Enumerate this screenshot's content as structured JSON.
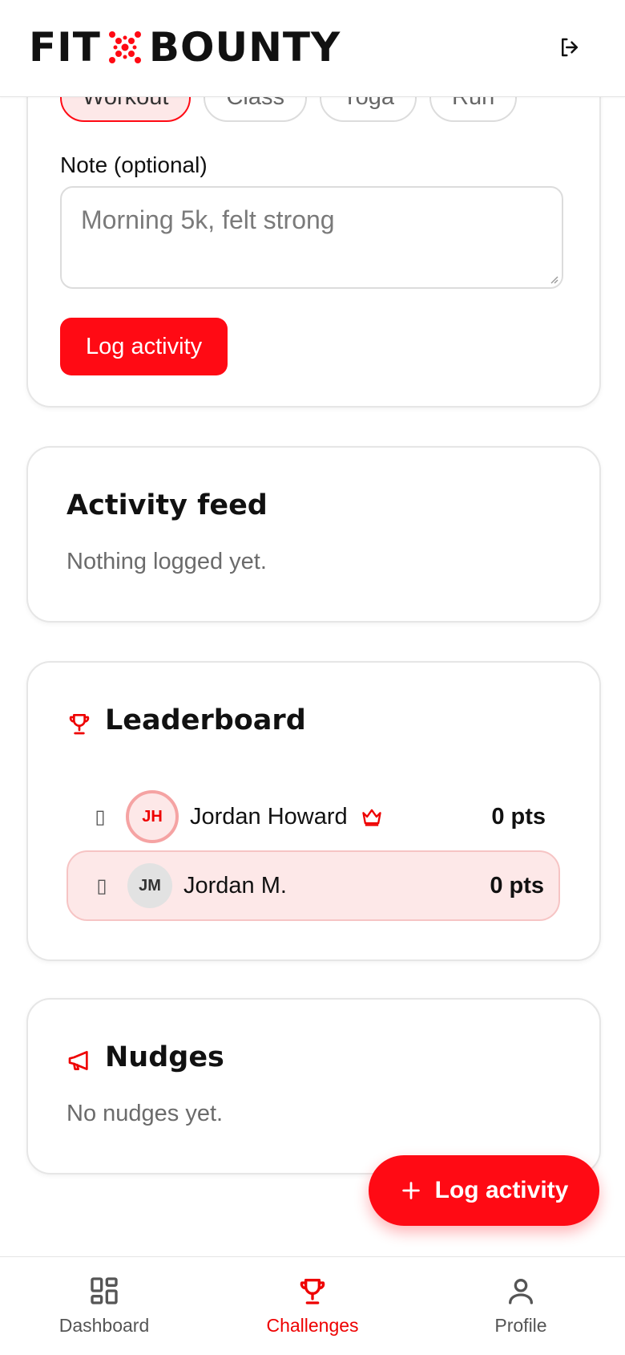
{
  "header": {
    "brand_left": "FIT",
    "brand_right": "BOUNTY",
    "logout_icon": "logout-icon"
  },
  "log_form": {
    "chips": [
      "Workout",
      "Class",
      "Yoga",
      "Run"
    ],
    "active_chip": "Workout",
    "note_label": "Note (optional)",
    "note_placeholder": "Morning 5k, felt strong",
    "submit_label": "Log activity"
  },
  "feed": {
    "title": "Activity feed",
    "empty": "Nothing logged yet."
  },
  "leaderboard": {
    "title": "Leaderboard",
    "rows": [
      {
        "rank_icon": "medal-icon",
        "initials": "JH",
        "name": "Jordan Howard",
        "points": "0 pts",
        "crown": true
      },
      {
        "rank_icon": "medal-icon",
        "initials": "JM",
        "name": "Jordan M.",
        "points": "0 pts",
        "crown": false
      }
    ]
  },
  "nudges": {
    "title": "Nudges",
    "empty": "No nudges yet."
  },
  "fab": {
    "label": "Log activity",
    "icon": "plus-icon"
  },
  "nav": {
    "items": [
      {
        "label": "Dashboard",
        "icon": "dashboard-icon"
      },
      {
        "label": "Challenges",
        "icon": "trophy-icon"
      },
      {
        "label": "Profile",
        "icon": "user-icon"
      }
    ],
    "active": "Challenges"
  },
  "colors": {
    "accent": "#ff0a14",
    "accent_soft": "#fde8e8",
    "text": "#111111",
    "muted": "#6b6b6b"
  }
}
